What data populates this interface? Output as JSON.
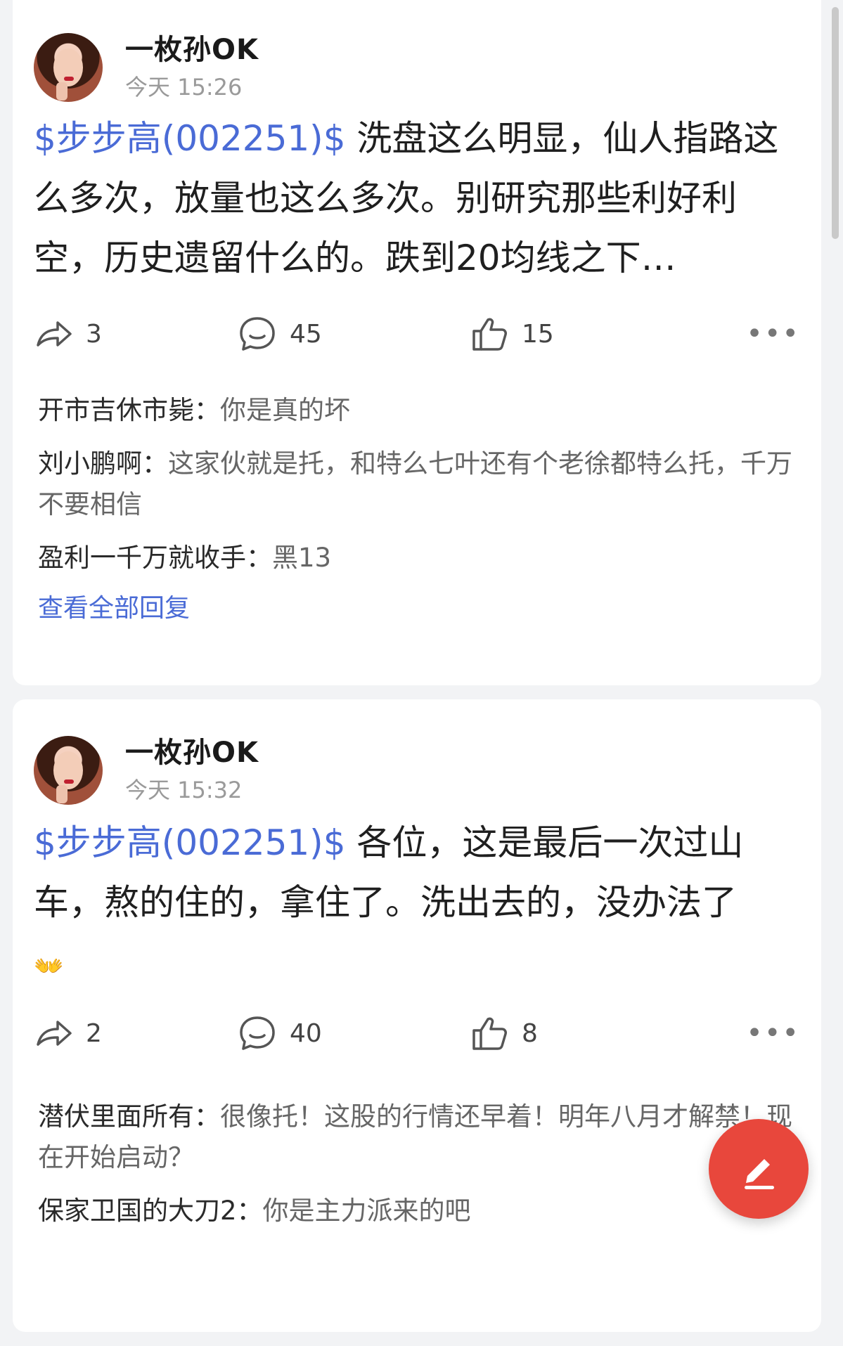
{
  "posts": [
    {
      "author": "一枚孙OK",
      "time": "今天 15:26",
      "stock_tag": "$步步高(002251)$",
      "text": " 洗盘这么明显，仙人指路这么多次，放量也这么多次。别研究那些利好利空，历史遗留什么的。跌到20均线之下…",
      "emoji": "",
      "shares": "3",
      "comments": "45",
      "likes": "15",
      "replies": [
        {
          "user": "开市吉休市毙：",
          "text": "你是真的坏"
        },
        {
          "user": "刘小鹏啊：",
          "text": "这家伙就是托，和特么七叶还有个老徐都特么托，千万不要相信"
        },
        {
          "user": "盈利一千万就收手：",
          "text": "黑13"
        }
      ],
      "view_all": "查看全部回复"
    },
    {
      "author": "一枚孙OK",
      "time": "今天 15:32",
      "stock_tag": "$步步高(002251)$",
      "text": " 各位，这是最后一次过山车，熬的住的，拿住了。洗出去的，没办法了",
      "emoji": "👐",
      "shares": "2",
      "comments": "40",
      "likes": "8",
      "replies": [
        {
          "user": "潜伏里面所有：",
          "text": "很像托！这股的行情还早着！明年八月才解禁！现在开始启动？"
        },
        {
          "user": "保家卫国的大刀2：",
          "text": "你是主力派来的吧"
        }
      ]
    }
  ],
  "more_glyph": "•••",
  "icons": {
    "share": "share-arrow-icon",
    "comment": "comment-bubble-icon",
    "like": "thumbs-up-icon",
    "compose": "pencil-icon"
  },
  "colors": {
    "accent_blue": "#4a6bd6",
    "fab_red": "#e8473c"
  }
}
